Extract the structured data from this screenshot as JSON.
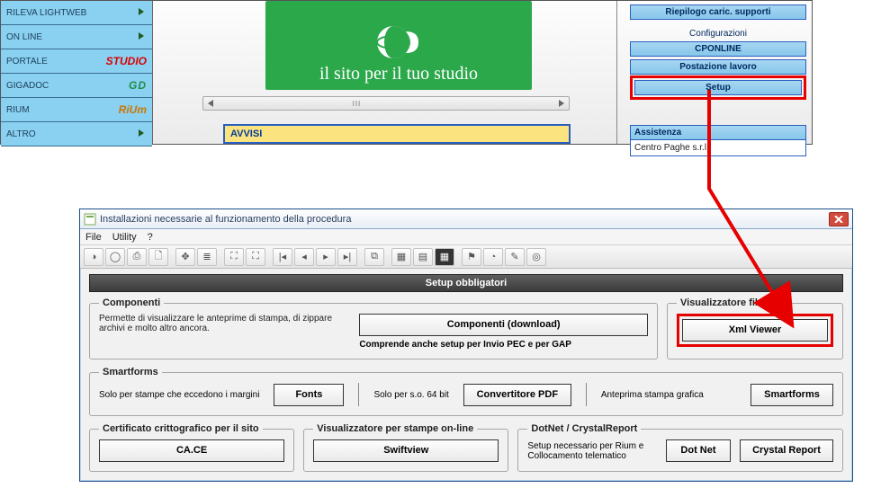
{
  "left_nav": {
    "items": [
      {
        "label": "RILEVA LIGHTWEB",
        "logo": ""
      },
      {
        "label": "ON LINE",
        "logo": ""
      },
      {
        "label": "PORTALE",
        "logo": "STUDIO"
      },
      {
        "label": "GIGADOC",
        "logo": "GD"
      },
      {
        "label": "RIUM",
        "logo": "RiUm"
      },
      {
        "label": "ALTRO",
        "logo": ""
      }
    ]
  },
  "banner": {
    "line": "il sito per il tuo studio"
  },
  "avvisi": {
    "label": "AVVISI"
  },
  "right_panel": {
    "btn_riepilogo": "Riepilogo caric. supporti",
    "label_config": "Configurazioni",
    "btn_cponline": "CPONLINE",
    "btn_postazione": "Postazione lavoro",
    "btn_setup": "Setup",
    "assist_head": "Assistenza",
    "assist_body": "Centro Paghe s.r.l."
  },
  "dialog": {
    "title": "Installazioni necessarie al funzionamento della procedura",
    "menu": {
      "file": "File",
      "utility": "Utility",
      "help": "?"
    },
    "section_title": "Setup obbligatori",
    "componenti": {
      "legend": "Componenti",
      "desc": "Permette di visualizzare le anteprime di stampa, di zippare archivi e molto altro ancora.",
      "btn": "Componenti (download)",
      "note": "Comprende anche setup per Invio PEC e per GAP"
    },
    "xml": {
      "legend": "Visualizzatore file XML",
      "btn": "Xml Viewer"
    },
    "smartforms": {
      "legend": "Smartforms",
      "note1": "Solo per stampe che eccedono i margini",
      "btn_fonts": "Fonts",
      "note2": "Solo per s.o. 64 bit",
      "btn_conv": "Convertitore PDF",
      "note3": "Anteprima stampa grafica",
      "btn_smart": "Smartforms"
    },
    "cert": {
      "legend": "Certificato crittografico per il sito",
      "btn": "CA.CE"
    },
    "visual": {
      "legend": "Visualizzatore per stampe on-line",
      "btn": "Swiftview"
    },
    "dotnet": {
      "legend": "DotNet / CrystalReport",
      "note": "Setup necessario per Rium e Collocamento telematico",
      "btn_dotnet": "Dot Net",
      "btn_crystal": "Crystal Report"
    }
  }
}
